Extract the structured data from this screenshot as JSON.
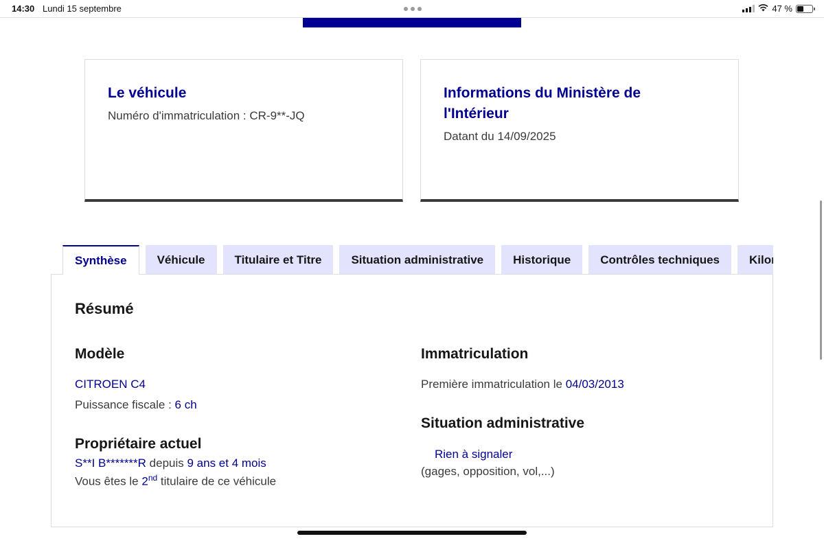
{
  "status_bar": {
    "time": "14:30",
    "date": "Lundi 15 septembre",
    "battery": "47 %"
  },
  "cards": {
    "vehicle": {
      "title": "Le véhicule",
      "desc": "Numéro d'immatriculation : CR-9**-JQ"
    },
    "ministry": {
      "title_line1": "Informations du Ministère de",
      "title_line2": "l'Intérieur",
      "desc": "Datant du 14/09/2025"
    }
  },
  "tabs": [
    {
      "label": "Synthèse",
      "active": true
    },
    {
      "label": "Véhicule"
    },
    {
      "label": "Titulaire et Titre"
    },
    {
      "label": "Situation administrative"
    },
    {
      "label": "Historique"
    },
    {
      "label": "Contrôles techniques"
    },
    {
      "label": "Kilométrage"
    }
  ],
  "summary": {
    "title": "Résumé",
    "model": {
      "heading": "Modèle",
      "name": "CITROEN C4",
      "power_label": "Puissance fiscale : ",
      "power_value": "6 ch"
    },
    "owner": {
      "heading": "Propriétaire actuel",
      "name": "S**I B*******R",
      "since_label": " depuis ",
      "since_value": "9 ans et 4 mois",
      "rank_prefix": "Vous êtes le ",
      "rank_num": "2",
      "rank_sup": "nd",
      "rank_suffix": " titulaire de ce véhicule"
    },
    "registration": {
      "heading": "Immatriculation",
      "label": "Première immatriculation le ",
      "date": "04/03/2013"
    },
    "admin": {
      "heading": "Situation administrative",
      "status": "Rien à signaler",
      "note": "(gages, opposition, vol,...)"
    }
  },
  "colors": {
    "accent": "#000091",
    "tab_bg": "#e3e3fd",
    "text": "#3a3a3a"
  }
}
